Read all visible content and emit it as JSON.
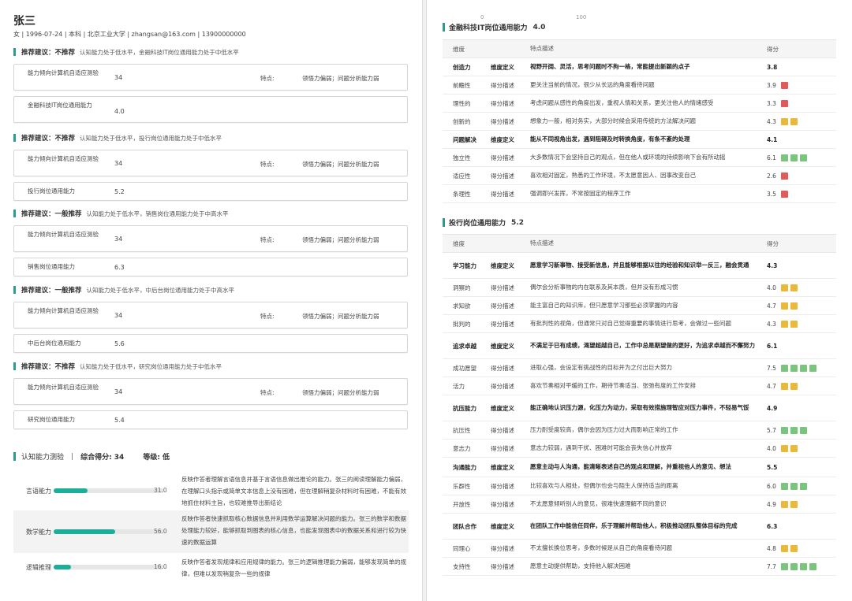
{
  "candidate": {
    "name": "张三",
    "info": "女 | 1996-07-24 | 本科 | 北京工业大学 | zhangsan@163.com | 13900000000"
  },
  "recommendations": [
    {
      "title": "推荐建议：不推荐",
      "desc": "认知能力处于低水平，金融科技IT岗位通用能力处于中低水平",
      "test_label": "能力倾向计算机自适应测验",
      "test_value": "34",
      "feature_label": "特点:",
      "feature_value": "领悟力偏弱；问题分析能力弱",
      "post_label": "金融科技IT岗位通用能力",
      "post_value": "4.0"
    },
    {
      "title": "推荐建议：不推荐",
      "desc": "认知能力处于低水平，投行岗位通用能力处于中低水平",
      "test_label": "能力倾向计算机自适应测验",
      "test_value": "34",
      "feature_label": "特点:",
      "feature_value": "领悟力偏弱；问题分析能力弱",
      "post_label": "投行岗位通用能力",
      "post_value": "5.2"
    },
    {
      "title": "推荐建议：一般推荐",
      "desc": "认知能力处于低水平，销售岗位通用能力处于中高水平",
      "test_label": "能力倾向计算机自适应测验",
      "test_value": "34",
      "feature_label": "特点:",
      "feature_value": "领悟力偏弱；问题分析能力弱",
      "post_label": "销售岗位通用能力",
      "post_value": "6.3"
    },
    {
      "title": "推荐建议：一般推荐",
      "desc": "认知能力处于低水平，中后台岗位通用能力处于中高水平",
      "test_label": "能力倾向计算机自适应测验",
      "test_value": "34",
      "feature_label": "特点:",
      "feature_value": "领悟力偏弱；问题分析能力弱",
      "post_label": "中后台岗位通用能力",
      "post_value": "5.6"
    },
    {
      "title": "推荐建议：不推荐",
      "desc": "认知能力处于低水平，研究岗位通用能力处于中低水平",
      "test_label": "能力倾向计算机自适应测验",
      "test_value": "34",
      "feature_label": "特点:",
      "feature_value": "领悟力偏弱；问题分析能力弱",
      "post_label": "研究岗位通用能力",
      "post_value": "5.4"
    }
  ],
  "cognitive": {
    "title": "认知能力测验",
    "sep": "|",
    "score_text": "综合得分: 34",
    "level_text": "等级: 低",
    "items": [
      {
        "label": "言语能力",
        "value": 31.0,
        "value_text": "31.0",
        "desc": "反映作答者理解言语信息并基于言语信息做出推论的能力。张三的阅读理解能力偏弱，在理解口头指示或简单文本信息上没有困难，但在理解稍复杂材料时有困难，不能有效地抓住材料主旨，也较难推导出新结论"
      },
      {
        "label": "数学能力",
        "value": 56.0,
        "value_text": "56.0",
        "desc": "反映作答者快速抓取核心数据信息并利用数学运算解决问题的能力。张三的数学和数据处理能力较好，能够抓取到图表的核心信息，也能发现图表中的数据关系和进行较为快速的数据运算"
      },
      {
        "label": "逻辑推理",
        "value": 16.0,
        "value_text": "16.0",
        "desc": "反映作答者发现规律和应用规律的能力。张三的逻辑推理能力偏弱，能够发现简单的规律，但难以发现稍复杂一些的规律"
      }
    ]
  },
  "axis": {
    "min_label": "0",
    "max_label": "100"
  },
  "competency_sections": [
    {
      "title": "金融科技IT岗位通用能力",
      "score": "4.0",
      "headers": {
        "dimension": "维度",
        "desc": "特点描述",
        "score": "得分"
      },
      "rows": [
        {
          "name": "创造力",
          "type": "维度定义",
          "desc": "视野开阔、灵活，思考问题时不拘一格，常能提出新颖的点子",
          "score": "3.8",
          "bold": true,
          "color": "",
          "squares": 0
        },
        {
          "name": "前瞻性",
          "type": "得分描述",
          "desc": "更关注当前的情况，很少从长远的角度看待问题",
          "score": "3.9",
          "bold": false,
          "color": "#e05a5a",
          "squares": 1
        },
        {
          "name": "理性的",
          "type": "得分描述",
          "desc": "考虑问题从感性的角度出发，重视人情和关系，更关注他人的情绪感受",
          "score": "3.3",
          "bold": false,
          "color": "#e05a5a",
          "squares": 1
        },
        {
          "name": "创新的",
          "type": "得分描述",
          "desc": "想象力一般，相对务实，大部分时候会采用传统的方法解决问题",
          "score": "4.3",
          "bold": false,
          "color": "#e8b93a",
          "squares": 2
        },
        {
          "name": "问题解决",
          "type": "维度定义",
          "desc": "能从不同视角出发，遇到阻碍及时转换角度，有条不紊的处理",
          "score": "4.1",
          "bold": true,
          "color": "",
          "squares": 0
        },
        {
          "name": "独立性",
          "type": "得分描述",
          "desc": "大多数情况下会坚持自己的观点，但在他人或环境的持续影响下会有所动摇",
          "score": "6.1",
          "bold": false,
          "color": "#7ac47e",
          "squares": 3
        },
        {
          "name": "适应性",
          "type": "得分描述",
          "desc": "喜欢相对固定，熟悉的工作环境，不太愿意因人、因事改变自己",
          "score": "2.6",
          "bold": false,
          "color": "#e05a5a",
          "squares": 1
        },
        {
          "name": "条理性",
          "type": "得分描述",
          "desc": "强调即兴发挥，不常按固定的程序工作",
          "score": "3.5",
          "bold": false,
          "color": "#e05a5a",
          "squares": 1
        }
      ]
    },
    {
      "title": "投行岗位通用能力",
      "score": "5.2",
      "headers": {
        "dimension": "维度",
        "desc": "特点描述",
        "score": "得分"
      },
      "rows": [
        {
          "name": "学习能力",
          "type": "维度定义",
          "desc": "愿意学习新事物、接受新信息，并且能够根据以往的经验和知识举一反三，融会贯通",
          "score": "4.3",
          "bold": true,
          "color": "",
          "squares": 0
        },
        {
          "name": "洞察的",
          "type": "得分描述",
          "desc": "偶尔会分析事物的内在联系及其本质，但并没有形成习惯",
          "score": "4.0",
          "bold": false,
          "color": "#e8b93a",
          "squares": 2
        },
        {
          "name": "求知欲",
          "type": "得分描述",
          "desc": "能主富自己的知识库，但只愿意学习那些必须掌握的内容",
          "score": "4.7",
          "bold": false,
          "color": "#e8b93a",
          "squares": 2
        },
        {
          "name": "批判的",
          "type": "得分描述",
          "desc": "有批判性的视角，但通常只对自己觉得重要的事情进行思考，会做过一些问题",
          "score": "4.3",
          "bold": false,
          "color": "#e8b93a",
          "squares": 2
        },
        {
          "name": "追求卓越",
          "type": "维度定义",
          "desc": "不满足于已有成绩，渴望超越自己，工作中总是期望做的更好，为追求卓越而不懈努力",
          "score": "6.1",
          "bold": true,
          "color": "",
          "squares": 0
        },
        {
          "name": "成功愿望",
          "type": "得分描述",
          "desc": "进取心强，会设定有挑战性的目标并为之付出巨大努力",
          "score": "7.5",
          "bold": false,
          "color": "#7ac47e",
          "squares": 4
        },
        {
          "name": "活力",
          "type": "得分描述",
          "desc": "喜欢节奏相对平缓的工作，期待节奏适当、张弛有度的工作安排",
          "score": "4.7",
          "bold": false,
          "color": "#e8b93a",
          "squares": 2
        },
        {
          "name": "抗压能力",
          "type": "维度定义",
          "desc": "能正确地认识压力源，化压力为动力，采取有效措施理智应对压力事件，不轻易气馁",
          "score": "4.9",
          "bold": true,
          "color": "",
          "squares": 0
        },
        {
          "name": "抗压性",
          "type": "得分描述",
          "desc": "压力耐受度较高，偶尔会因为压力过大而影响正常的工作",
          "score": "5.7",
          "bold": false,
          "color": "#7ac47e",
          "squares": 3
        },
        {
          "name": "意志力",
          "type": "得分描述",
          "desc": "意志力较弱，遇到干扰、困难时可能会丧失信心并放弃",
          "score": "4.0",
          "bold": false,
          "color": "#e8b93a",
          "squares": 2
        },
        {
          "name": "沟通能力",
          "type": "维度定义",
          "desc": "愿意主动与人沟通，能清晰表述自己的观点和理解，并重视他人的意见、想法",
          "score": "5.5",
          "bold": true,
          "color": "",
          "squares": 0
        },
        {
          "name": "乐群性",
          "type": "得分描述",
          "desc": "比较喜欢与人相处，但偶尔也会与陌生人保持适当的距离",
          "score": "6.0",
          "bold": false,
          "color": "#7ac47e",
          "squares": 3
        },
        {
          "name": "开放性",
          "type": "得分描述",
          "desc": "不太愿意倾听别人的意见，很难快速理解不同的意识",
          "score": "4.9",
          "bold": false,
          "color": "#e8b93a",
          "squares": 2
        },
        {
          "name": "团队合作",
          "type": "维度定义",
          "desc": "在团队工作中能信任同伴，乐于理解并帮助他人，积极推动团队整体目标的完成",
          "score": "6.3",
          "bold": true,
          "color": "",
          "squares": 0
        },
        {
          "name": "同理心",
          "type": "得分描述",
          "desc": "不太擅长换位思考，多数时候是从自己的角度看待问题",
          "score": "4.8",
          "bold": false,
          "color": "#e8b93a",
          "squares": 2
        },
        {
          "name": "支持性",
          "type": "得分描述",
          "desc": "愿意主动提供帮助，支持他人解决困难",
          "score": "7.7",
          "bold": false,
          "color": "#7ac47e",
          "squares": 4
        }
      ]
    }
  ]
}
